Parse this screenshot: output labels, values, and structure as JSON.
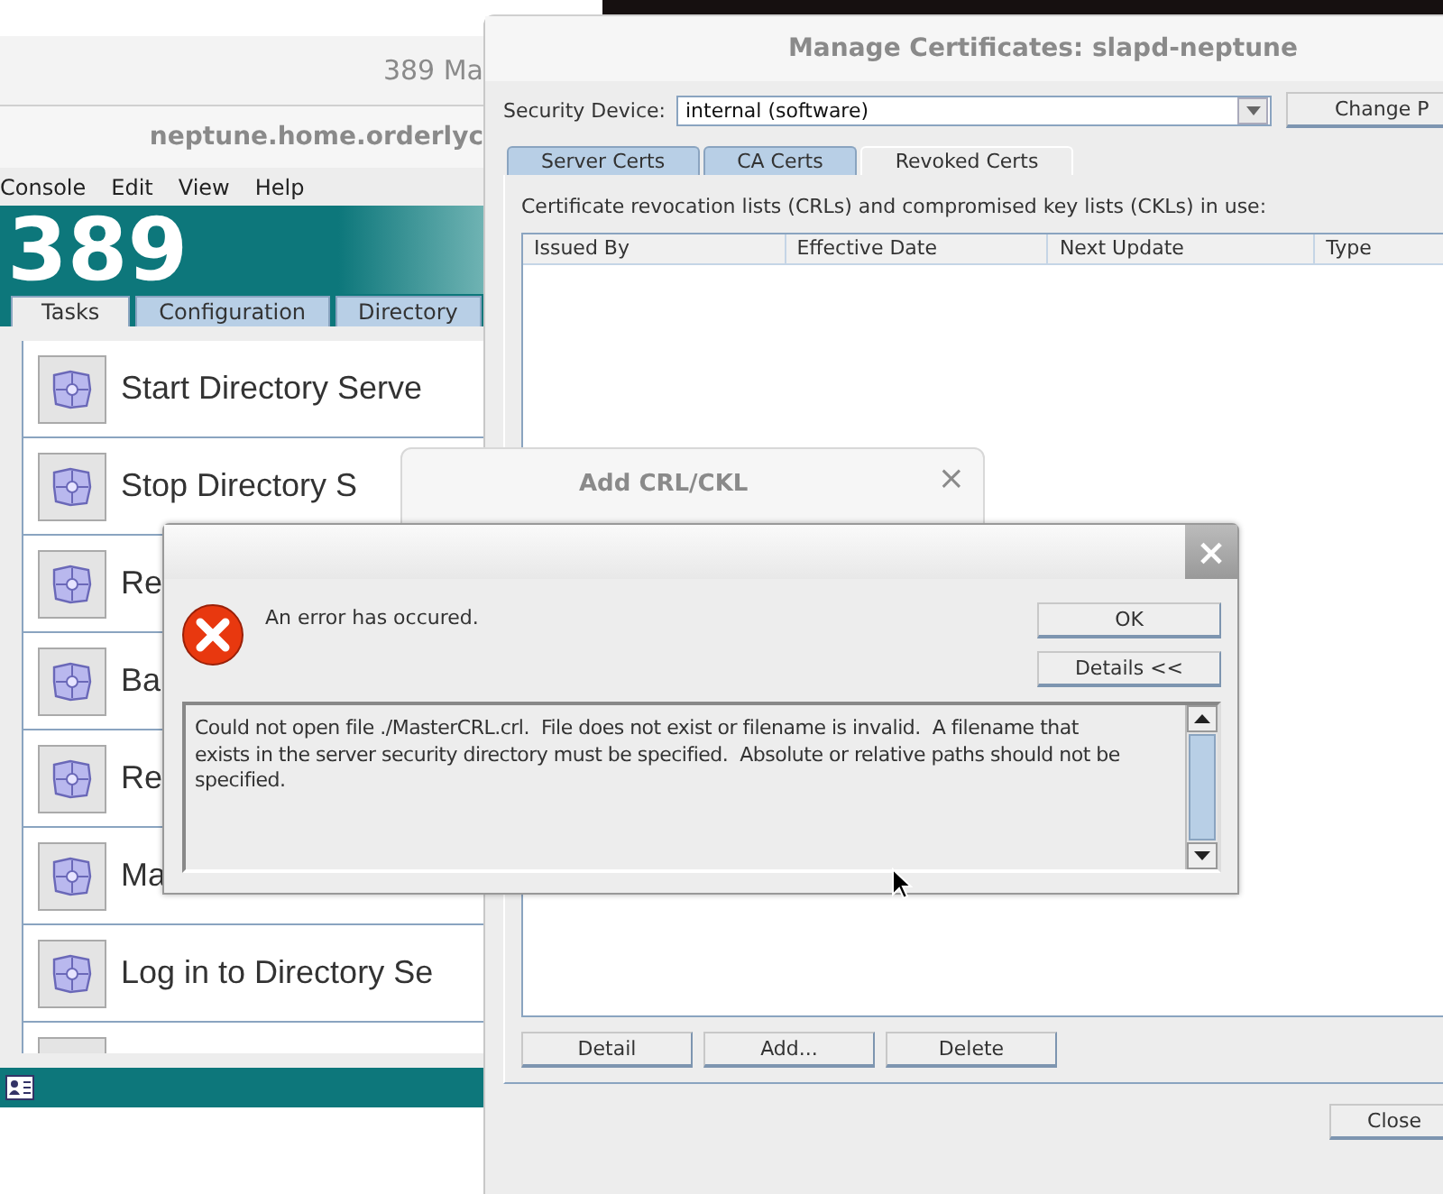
{
  "main_window": {
    "title": "389 Ma",
    "subtitle": "neptune.home.orderlyc",
    "menu": [
      "Console",
      "Edit",
      "View",
      "Help"
    ],
    "logo": "389",
    "tabs": [
      {
        "label": "Tasks",
        "selected": true
      },
      {
        "label": "Configuration",
        "selected": false
      },
      {
        "label": "Directory",
        "selected": false
      }
    ],
    "tasks": [
      "Start Directory Serve",
      "Stop Directory S",
      "Re",
      "Ba",
      "Re",
      "Ma",
      "Log in to Directory Se"
    ]
  },
  "cert_window": {
    "title": "Manage Certificates: slapd-neptune",
    "device_label": "Security Device:",
    "device_value": "internal (software)",
    "change_button": "Change P",
    "tabs": [
      {
        "label": "Server Certs",
        "selected": false
      },
      {
        "label": "CA Certs",
        "selected": false
      },
      {
        "label": "Revoked Certs",
        "selected": true
      }
    ],
    "description": "Certificate revocation lists (CRLs) and compromised key lists (CKLs) in use:",
    "columns": [
      "Issued By",
      "Effective Date",
      "Next Update",
      "Type"
    ],
    "buttons": [
      "Detail",
      "Add...",
      "Delete"
    ],
    "close_button": "Close"
  },
  "add_dialog": {
    "title": "Add CRL/CKL",
    "close": "×"
  },
  "error_dialog": {
    "close": "×",
    "message": "An error has occured.",
    "ok_button": "OK",
    "details_button": "Details <<",
    "details": "Could not open file ./MasterCRL.crl.  File does not exist or filename is invalid.  A filename that exists in the server security directory must be specified.  Absolute or relative paths should not be specified."
  }
}
